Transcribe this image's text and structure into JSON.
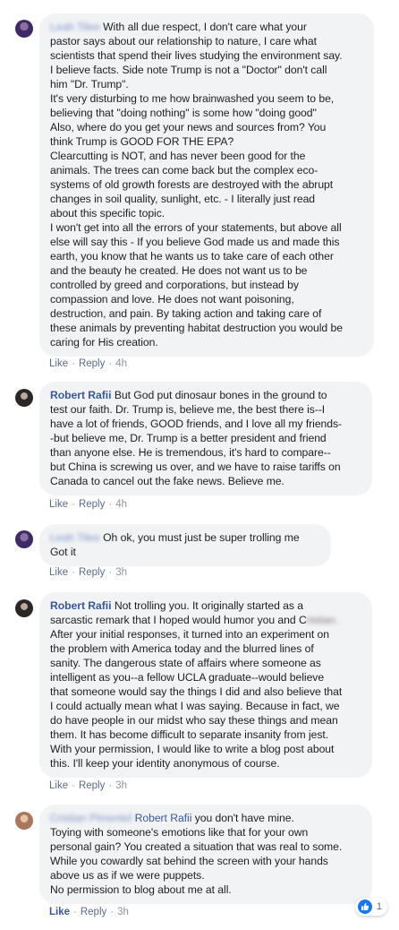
{
  "comments": [
    {
      "author": "Leah Tilee",
      "lines": [
        "With all due respect, I don't care what your",
        "pastor says about our relationship to nature, I care what",
        "scientists that spend their lives studying the environment say.",
        "I believe facts. Side note Trump is not a \"Doctor\" don't call",
        "him \"Dr. Trump\".",
        "It's very disturbing to me how brainwashed you seem to be,",
        "believing that \"doing nothing\" is some how \"doing good\"",
        "Also, where do you get your news and sources from? You",
        "think Trump is GOOD FOR THE EPA?",
        "Clearcutting is NOT, and has never been good for the",
        "animals. The trees can come back but the complex eco-",
        "systems of old growth forests are destroyed with the abrupt",
        "changes in soil quality, sunlight, etc. - I literally just read",
        "about this specific topic.",
        "I won't get into all the errors of your statements, but above all",
        "else will say this - If you believe God made us and made this",
        "earth, you know that he wants us to take care of each other",
        "and the beauty he created. He does not want us to be",
        "controlled by greed and corporations, but instead by",
        "compassion and love. He does not want poisoning,",
        "destruction, and pain. By taking action and taking care of",
        "these animals by preventing habitat destruction you would be",
        "caring for His creation."
      ],
      "like": "Like",
      "reply": "Reply",
      "time": "4h"
    },
    {
      "author": "Robert Rafii",
      "lines": [
        "But God put dinosaur bones in the ground to",
        "test our faith. Dr. Trump is, believe me, the best there is--I",
        "have a lot of friends, GOOD friends, and I love all my friends-",
        "-but believe me, Dr. Trump is a better president and friend",
        "than anyone else. He is tremendous, it's hard to compare--",
        "but China is screwing us over, and we have to raise tariffs on",
        "Canada to cancel out the fake news. Believe me."
      ],
      "like": "Like",
      "reply": "Reply",
      "time": "4h"
    },
    {
      "author": "Leah Tilee",
      "lines": [
        "Oh ok, you must just be super trolling me",
        "Got it"
      ],
      "like": "Like",
      "reply": "Reply",
      "time": "3h"
    },
    {
      "author": "Robert Rafii",
      "lines": [
        "Not trolling you. It originally started as a",
        "sarcastic remark that I hoped would humor you and C",
        "After your initial responses, it turned into an experiment on",
        "the problem with America today and the blurred lines of",
        "sanity. The dangerous state of affairs where someone as",
        "intelligent as you--a fellow UCLA graduate--would believe",
        "that someone would say the things I did and also believe that",
        "I could actually mean what I was saying. Because in fact, we",
        "do have people in our midst who say these things and mean",
        "them. It has become difficult to separate insanity from jest.",
        "With your permission, I would like to write a blog post about",
        "this. I'll keep your identity anonymous of course."
      ],
      "blurred_fragment": "ristian.",
      "like": "Like",
      "reply": "Reply",
      "time": "3h"
    },
    {
      "author": "Cristian Pimentel",
      "mention": "Robert Rafii",
      "lines": [
        "you don't have mine.",
        "Toying with someone's emotions like that for your own",
        "personal gain? You created a situation that was real to some.",
        "While you cowardly sat behind the screen with your hands",
        "above us as if we were puppets.",
        "No permission to blog about me at all."
      ],
      "like": "Like",
      "reply": "Reply",
      "time": "3h",
      "reaction_count": "1"
    }
  ],
  "separator": "·"
}
